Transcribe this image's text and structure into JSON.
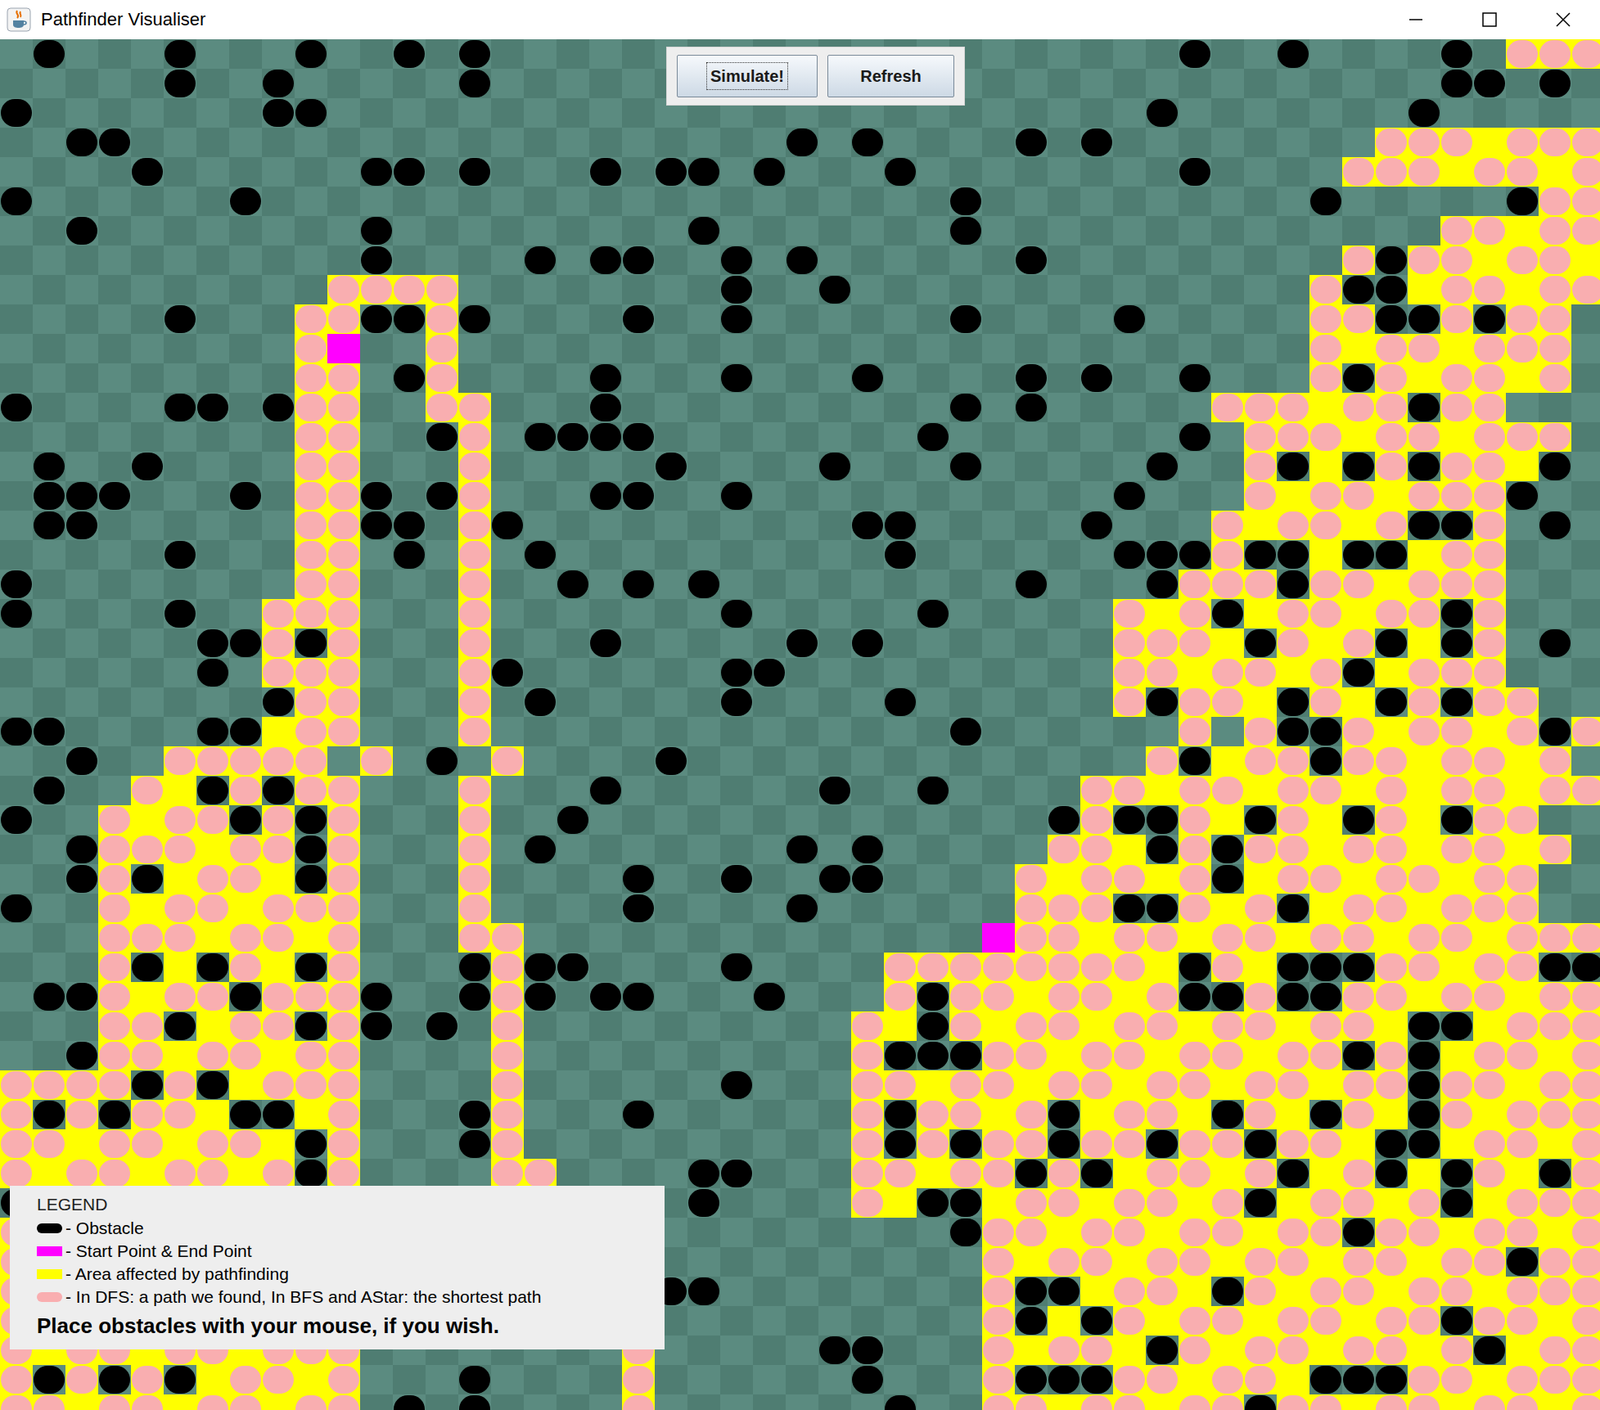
{
  "window": {
    "title": "Pathfinder Visualiser"
  },
  "buttons": [
    {
      "label": "Simulate!",
      "focused": true
    },
    {
      "label": "Refresh",
      "focused": false
    }
  ],
  "legend": {
    "title": "LEGEND",
    "items": [
      {
        "kind": "obstacle",
        "color": "#000000",
        "text": "- Obstacle"
      },
      {
        "kind": "endpoint",
        "color": "#ff00ff",
        "text": "- Start Point & End Point"
      },
      {
        "kind": "area",
        "color": "#ffff00",
        "text": "- Area affected by pathfinding"
      },
      {
        "kind": "path",
        "color": "#f9aeb0",
        "text": "- In DFS: a path we found, In BFS and AStar: the shortest path"
      }
    ],
    "hint": "Place obstacles with your mouse, if you wish."
  },
  "grid": {
    "columns": 49,
    "rows": [
      ".#...#...#..#.#.....................#..#....#.ppp",
      ".....#..#.....#.............................##.#.....ppppvp",
      "#.......##.........................#.......#.........#.pppvpp",
      "..##....................#.#....#.#........pppvppp",
      "....#......##.#...#.##.#...#........#....pppvppvp",
      "#......#.....................#..........#.....#ppvppvpp",
      "..#........#.........#.......#..............ppvppvpp#",
      "...........#....#.##..#.#......#.........p#ppvppvp",
      "..........pppp........#..#..............p##vppvpp",
      ".....#...pp##p#....#..#......#....#.....pp##p#pp.",
      ".........pS..p..........................pvppvppp.",
      ".........pp.#p....#...#...#....#.#..#...p#pvppvp.",
      "#....##.#pp..pp...#..........#.#.....pppvpp#pp.",
      ".........pp..#p.####........#.......#.pppvppvppp.",
      ".#..#....pp...p.....#....#...#.....#..p#v#p#ppv#.",
      ".###...#.pp#.#p...##..#...........#...pvppvppp#..",
      ".##......pp##.p#..........##.....#...pvppvp##p.#.",
      ".....#...pp.#.p.#..........#......###p##v##vpp...",
      "#........pp...p..#.#.#.........#...#ppp#ppvppp...",
      "#....#..ppp...p.......#.....#.....pvp#vppvpp#p...",
      "......##p#p...p...#.....#.#.......pppv#pvp#v#p.#.",
      "......#.ppp...p#......##..........ppvppvp#vppp...",
      "........#pp...p.#.....#....#......p#ppv#pv#p#pp..",
      "##....##vpp...p..............#......p.p##pvppvp#p..",
      "..#..ppppp.p.#.p....#..............p#vpp#ppvppvp..",
      ".#..pv#p#pp...p...#......#..#....ppvppvppvpvppvpp..",
      "#..pvpp#p#p...p..#..............#p##pv#pv#pv#pp..",
      "..#pppvpp#p...p.#.......#.#.....ppv#p#ppvppvppvp..",
      "..#p#vppv#p...p....#..#..##....pvppvp#vppvppvpp..",
      "#..pvppvppp...p....#....#......ppp##pvp#vppvppp..",
      "...pppvppvp...pp..............Eppvppvppvppvppvppp",
      "...p#v#pv#p...#p##....#....ppppppppv#pv###ppvpp##",
      ".##pvpp#ppp#..#p#.##...#...p#ppvppvp##p##ppvppvpp",
      "...pp#vpp#p#.#.p..........pv#pvppvppvppvppv##vppp",
      "..#ppvppvpp....p..........p###ppvppvppvpp#p#vppvp",
      "pppp#p#vppp....p......#...ppvppvppvppvppvpp#ppvpp",
      "p#p#ppv##vp...#p...#......p#ppvp#vppv#pv#pv#pvppp",
      "ppvppvppv#p...#p..........p#p#pp#pp#pp#ppv##vppvp",
      "pvppvppvp#p....pp....##...ppvpp#p#vppvp#vp#v#pv#p",
      "#ppvppvppvp.....pp...#....pv##vppvppvp#vppvp#vppp",
      "ppvppvppvpp......pp..........#ppvppvppvpp#ppvppvp",
      "pvppvppvppp.......p...........pvppvppvppvppvpp#pp",
      "pppvppvppvp.......pp##........p##vppv#pvppvppvppp",
      "ppvppvppvpp........p..........p#v#pvppvppvpp#ppvp",
      "pvppvppvppp........p.....##...pvppv#pvppvppvp#vpp",
      "p#p#p#vppvp...#....p......#...p###ppvppv###ppvppp",
      "ppvppvppvpp.#.#....p.......#..ppvppvpp#ppvppvppvp"
    ]
  }
}
